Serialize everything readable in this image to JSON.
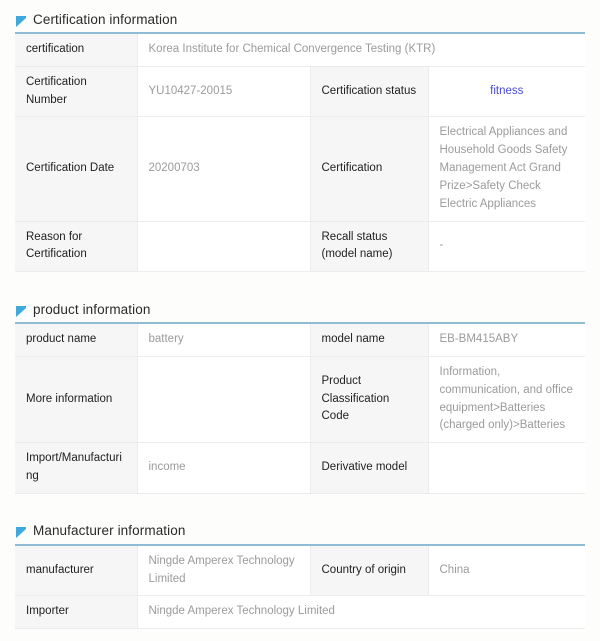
{
  "page": {
    "accent_blue": "#8fbcd4",
    "link_color": "#4a4ad0",
    "label_bg": "#f6f6f6",
    "value_text": "#9b9b9b"
  },
  "sections": [
    {
      "id": "certification-information",
      "title": "Certification information",
      "icon": "flag-marker-icon",
      "rows": [
        {
          "cells": [
            {
              "type": "label",
              "text": "certification"
            },
            {
              "type": "value",
              "text": "Korea Institute for Chemical Convergence Testing (KTR)",
              "colspan": 3
            }
          ]
        },
        {
          "cells": [
            {
              "type": "label",
              "text": "Certification Number"
            },
            {
              "type": "value",
              "text": "YU10427-20015"
            },
            {
              "type": "label",
              "text": "Certification status"
            },
            {
              "type": "link",
              "text": "fitness"
            }
          ]
        },
        {
          "cells": [
            {
              "type": "label",
              "text": "Certification Date"
            },
            {
              "type": "value",
              "text": "20200703"
            },
            {
              "type": "label",
              "text": "Certification"
            },
            {
              "type": "value",
              "text": "Electrical Appliances and Household Goods Safety Management Act Grand Prize>Safety Check Electric Appliances"
            }
          ]
        },
        {
          "cells": [
            {
              "type": "label",
              "text": "Reason for Certification"
            },
            {
              "type": "value",
              "text": ""
            },
            {
              "type": "label",
              "text": "Recall status (model name)"
            },
            {
              "type": "value",
              "text": "-"
            }
          ]
        }
      ]
    },
    {
      "id": "product-information",
      "title": "product information",
      "icon": "flag-marker-icon",
      "rows": [
        {
          "cells": [
            {
              "type": "label",
              "text": "product name"
            },
            {
              "type": "value",
              "text": "battery"
            },
            {
              "type": "label",
              "text": "model name"
            },
            {
              "type": "value",
              "text": "EB-BM415ABY"
            }
          ]
        },
        {
          "cells": [
            {
              "type": "label",
              "text": "More information"
            },
            {
              "type": "value",
              "text": ""
            },
            {
              "type": "label",
              "text": "Product Classification Code"
            },
            {
              "type": "value",
              "text": "Information, communication, and office equipment>Batteries (charged only)>Batteries"
            }
          ]
        },
        {
          "cells": [
            {
              "type": "label",
              "text": "Import/Manufacturing"
            },
            {
              "type": "value",
              "text": "income"
            },
            {
              "type": "label",
              "text": "Derivative model"
            },
            {
              "type": "value",
              "text": ""
            }
          ]
        }
      ]
    },
    {
      "id": "manufacturer-information",
      "title": "Manufacturer information",
      "icon": "flag-marker-icon",
      "rows": [
        {
          "cells": [
            {
              "type": "label",
              "text": "manufacturer"
            },
            {
              "type": "value",
              "text": "Ningde Amperex Technology Limited"
            },
            {
              "type": "label",
              "text": "Country of origin"
            },
            {
              "type": "value",
              "text": "China"
            }
          ]
        },
        {
          "cells": [
            {
              "type": "label",
              "text": "Importer"
            },
            {
              "type": "value",
              "text": "Ningde Amperex Technology Limited",
              "colspan": 3
            }
          ]
        }
      ]
    }
  ]
}
